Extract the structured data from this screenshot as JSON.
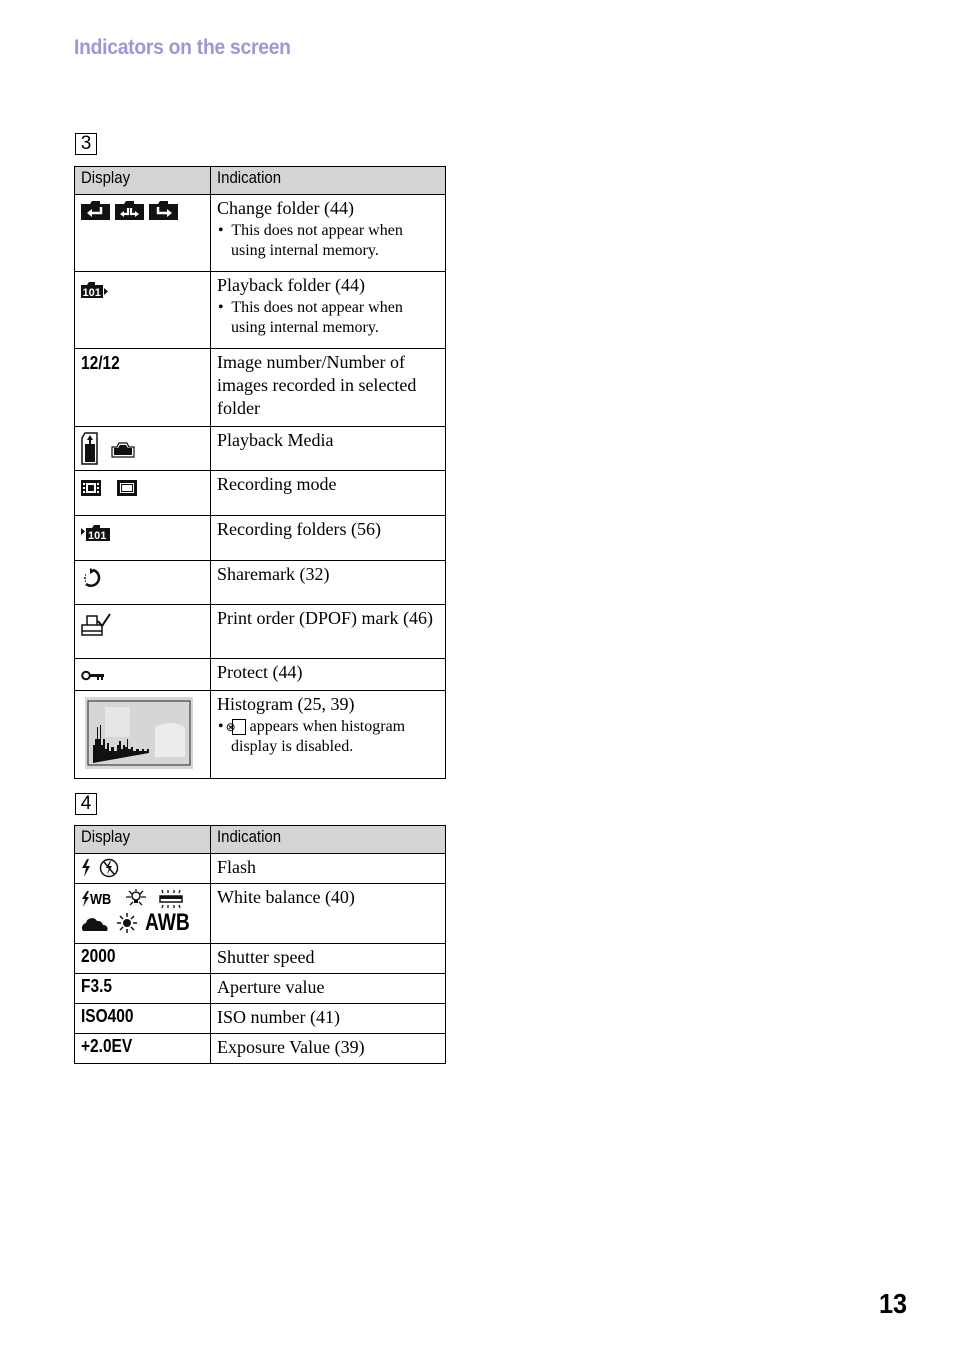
{
  "page": {
    "title": "Indicators on the screen",
    "page_number": "13",
    "accent_color": "#9f96d3"
  },
  "section3": {
    "number": "3",
    "headers": {
      "display": "Display",
      "indication": "Indication"
    },
    "rows": [
      {
        "display_icons": [
          "folder-back-icon",
          "folder-both-icon",
          "folder-forward-icon"
        ],
        "indication": "Change folder (44)",
        "note": "This does not appear when using internal memory."
      },
      {
        "display_icons": [
          "playback-folder-101-icon"
        ],
        "indication": "Playback folder (44)",
        "note": "This does not appear when using internal memory."
      },
      {
        "display_text": "12/12",
        "indication": "Image number/Number of images recorded in selected folder"
      },
      {
        "display_icons": [
          "memory-stick-icon",
          "internal-memory-icon"
        ],
        "indication": "Playback Media"
      },
      {
        "display_icons": [
          "movie-mode-icon",
          "still-mode-icon"
        ],
        "indication": "Recording mode"
      },
      {
        "display_icons": [
          "recording-folder-101-icon"
        ],
        "indication": "Recording folders (56)"
      },
      {
        "display_icons": [
          "sharemark-icon"
        ],
        "indication": "Sharemark (32)"
      },
      {
        "display_icons": [
          "print-order-icon"
        ],
        "indication": "Print order (DPOF) mark (46)"
      },
      {
        "display_icons": [
          "protect-key-icon"
        ],
        "indication": "Protect (44)"
      },
      {
        "display_icons": [
          "histogram-icon"
        ],
        "indication": "Histogram (25, 39)",
        "note_icon": "histogram-disabled-icon",
        "note_icon_glyph": "⊗",
        "note": "appears when histogram display is disabled."
      }
    ]
  },
  "section4": {
    "number": "4",
    "headers": {
      "display": "Display",
      "indication": "Indication"
    },
    "rows": [
      {
        "display_icons": [
          "flash-icon",
          "flash-off-icon"
        ],
        "indication": "Flash"
      },
      {
        "display_icons": [
          "flash-wb-icon",
          "incandescent-icon",
          "fluorescent-icon",
          "cloudy-icon",
          "daylight-icon",
          "auto-wb-icon"
        ],
        "wb_labels": {
          "flash_wb": "WB",
          "awb": "AWB"
        },
        "indication": "White balance (40)"
      },
      {
        "display_text": "2000",
        "indication": "Shutter speed"
      },
      {
        "display_text": "F3.5",
        "indication": "Aperture value"
      },
      {
        "display_text": "ISO400",
        "indication": "ISO number (41)"
      },
      {
        "display_text": "+2.0EV",
        "indication": "Exposure Value (39)"
      }
    ]
  }
}
